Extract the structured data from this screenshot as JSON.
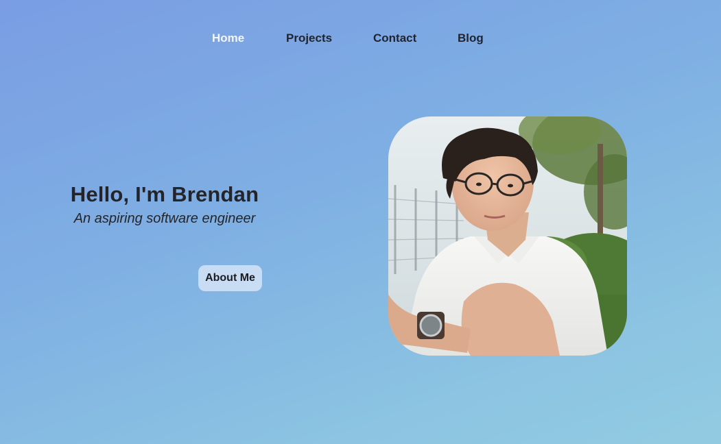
{
  "nav": {
    "items": [
      {
        "label": "Home",
        "active": true
      },
      {
        "label": "Projects",
        "active": false
      },
      {
        "label": "Contact",
        "active": false
      },
      {
        "label": "Blog",
        "active": false
      }
    ]
  },
  "hero": {
    "title": "Hello, I'm Brendan",
    "subtitle": "An aspiring software engineer",
    "button_label": "About Me"
  },
  "portrait": {
    "alt": "portrait-photo"
  },
  "colors": {
    "background_start": "#7a9de3",
    "background_end": "#92cbe1",
    "nav_active": "#f2f5fb",
    "text_dark": "#23252b",
    "button_bg": "#dce8f8"
  }
}
